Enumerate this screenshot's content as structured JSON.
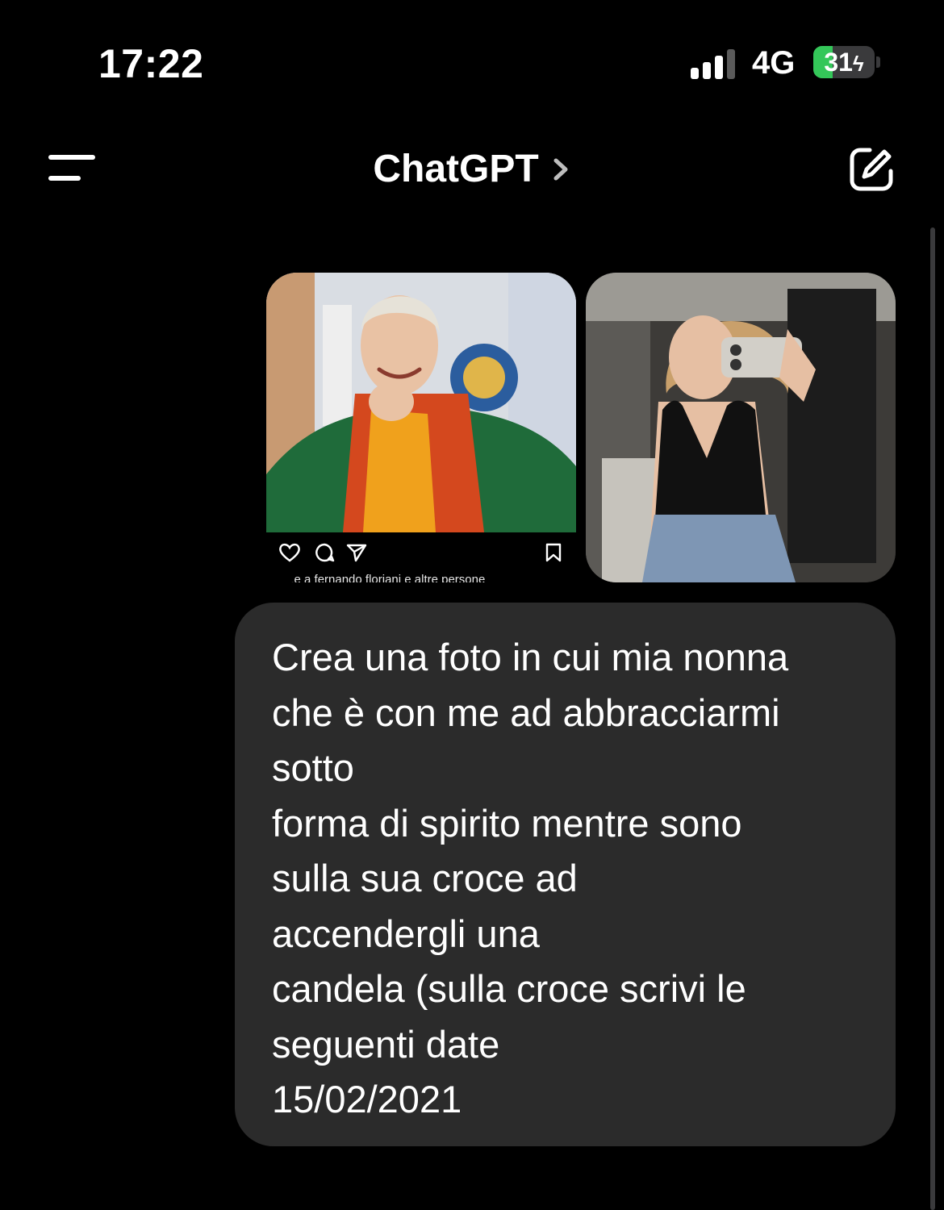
{
  "status_bar": {
    "time": "17:22",
    "network": "4G",
    "battery_percent": 31,
    "battery_label": "31",
    "signal_bars_active": 3,
    "signal_bars_total": 4
  },
  "header": {
    "title": "ChatGPT",
    "icons": [
      "menu-icon",
      "chevron-right-icon",
      "compose-icon"
    ]
  },
  "attachments": [
    {
      "kind": "instagram-screenshot",
      "caption": "...e a fernando floriani e altre persone",
      "icons": [
        "heart-icon",
        "comment-icon",
        "share-icon",
        "bookmark-icon"
      ]
    },
    {
      "kind": "photo"
    }
  ],
  "message": {
    "lines": [
      "Crea una foto in cui mia nonna",
      "che è con me ad abbracciarmi",
      "sotto",
      "forma di spirito mentre sono",
      "sulla sua croce ad",
      "accendergli una",
      "candela (sulla croce scrivi le",
      "seguenti date",
      "15/02/2021"
    ]
  },
  "colors": {
    "background": "#000000",
    "bubble": "#2b2b2b",
    "battery_fill": "#34c759",
    "text": "#ffffff"
  }
}
